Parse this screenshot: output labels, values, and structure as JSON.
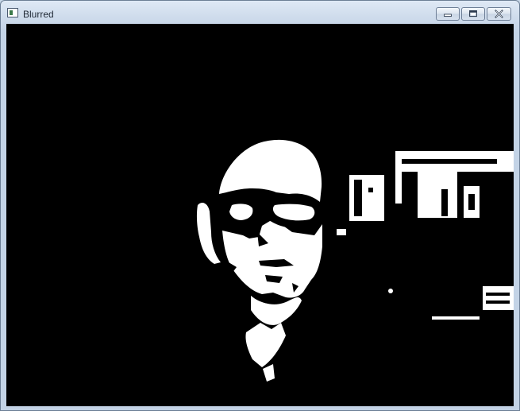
{
  "window": {
    "title": "Blurred",
    "icon": "opencv-window-icon",
    "controls": {
      "minimize": "minimize-icon",
      "maximize": "maximize-icon",
      "close": "close-icon"
    }
  },
  "image": {
    "description_visible": "",
    "foreground": "#ffffff",
    "background": "#000000"
  }
}
